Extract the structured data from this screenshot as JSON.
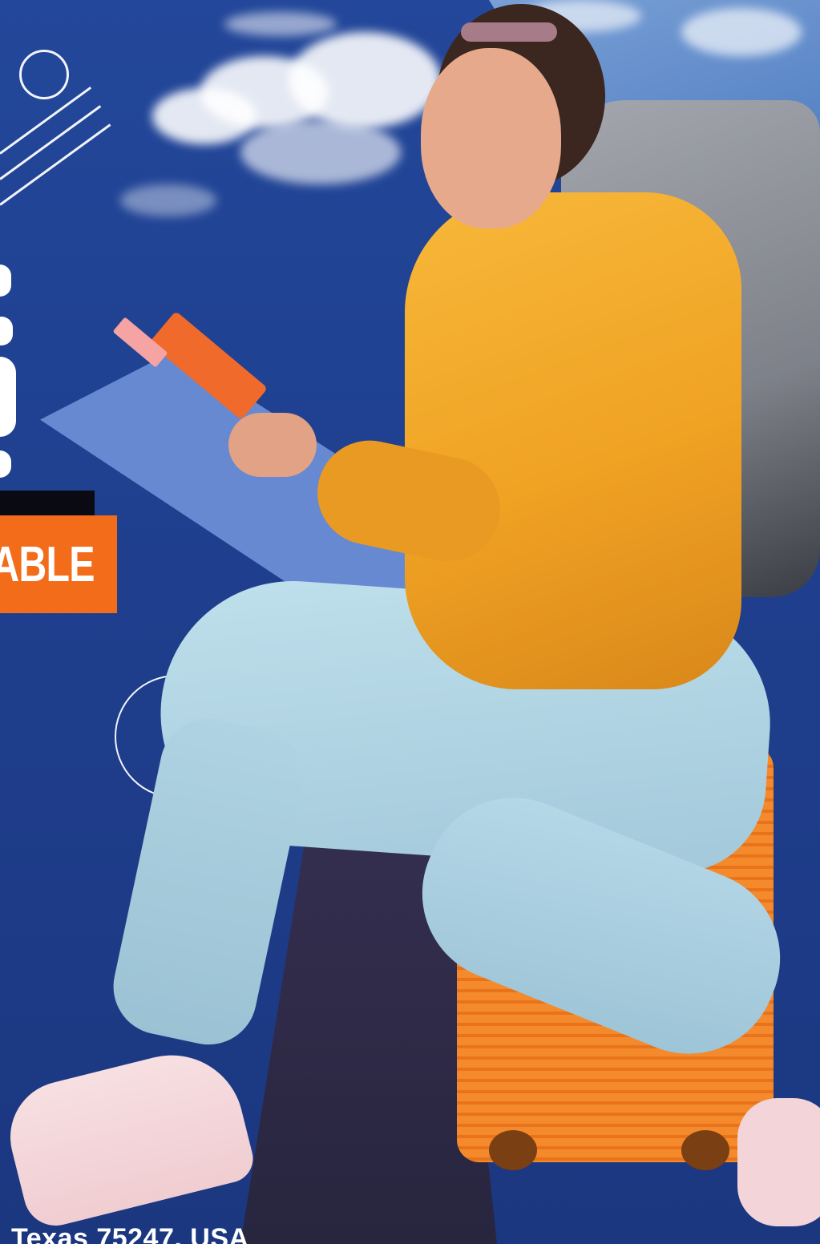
{
  "tag": {
    "text": "ABLE"
  },
  "footer": {
    "address": "Texas 75247, USA"
  },
  "colors": {
    "background": "#1f3f8e",
    "accent_orange": "#f26c1a",
    "stripe_blue": "#6d8fd8",
    "hoodie_yellow": "#f2a82a",
    "jeans_blue": "#a9cfe0",
    "backpack_gray": "#8d9097",
    "strap_teal": "#1f8c87"
  },
  "icons": [
    "circle-outline-icon",
    "diagonal-lines-icon",
    "ring-outline-icon"
  ]
}
